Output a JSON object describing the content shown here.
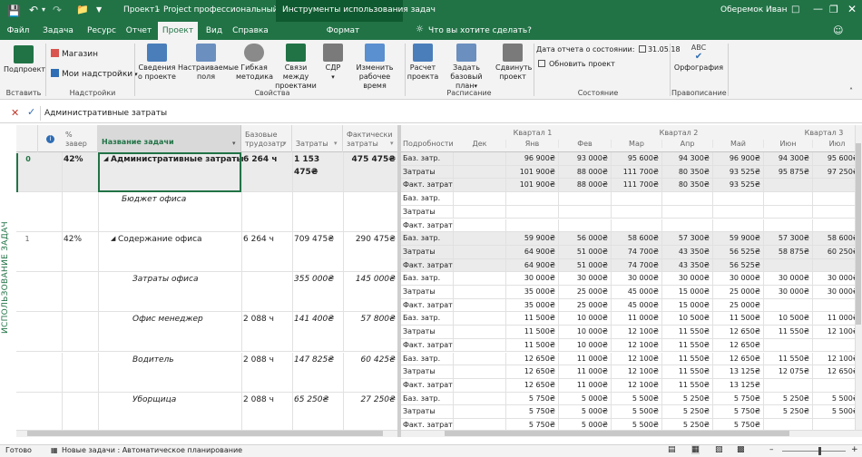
{
  "title": {
    "doc": "Проект1",
    "sep": "-",
    "app": "Project профессиональный",
    "context": "Инструменты использования задач",
    "user": "Оберемок Иван"
  },
  "tabs": [
    "Файл",
    "Задача",
    "Ресурс",
    "Отчет",
    "Проект",
    "Вид",
    "Справка",
    "Формат"
  ],
  "search_hint": "Что вы хотите сделать?",
  "ribbon": {
    "podproekt": "Подпроект",
    "magazin": "Магазин",
    "nadstroyki": "Мои надстройки",
    "svedeniya": [
      "Сведения",
      "о проекте"
    ],
    "pole": [
      "Настраиваемые",
      "поля"
    ],
    "metodika": [
      "Гибкая",
      "методика"
    ],
    "svyazi": [
      "Связи между",
      "проектами"
    ],
    "sdr": "СДР",
    "izmenit": [
      "Изменить",
      "рабочее время"
    ],
    "raschet": [
      "Расчет",
      "проекта"
    ],
    "bazovy": [
      "Задать базовый",
      "план"
    ],
    "sdvinut": [
      "Сдвинуть",
      "проект"
    ],
    "data_otcheta_label": "Дата отчета о состоянии:",
    "data_otcheta": "31.05.18",
    "obnovit": "Обновить проект",
    "orfografiya": "Орфография",
    "abc": "ABC",
    "groups": [
      "Вставить",
      "Надстройки",
      "Свойства",
      "Расписание",
      "Состояние",
      "Правописание"
    ]
  },
  "formula": "Административные затраты",
  "side_label": "ИСПОЛЬЗОВАНИЕ ЗАДАЧ",
  "left_headers": {
    "pct": [
      "%",
      "завер"
    ],
    "name": "Название задачи",
    "base": [
      "Базовые",
      "трудозатр"
    ],
    "cost": "Затраты",
    "actual": [
      "Фактически",
      "затраты"
    ]
  },
  "right_headers": {
    "details": "Подробности",
    "q1": "Квартал 1",
    "q2": "Квартал 2",
    "q3": "Квартал 3",
    "months": [
      "Дек",
      "Янв",
      "Фев",
      "Мар",
      "Апр",
      "Май",
      "Июн",
      "Июл"
    ]
  },
  "rows": [
    {
      "id": "0",
      "pct": "42%",
      "name": "Административные затраты",
      "base": "6 264 ч",
      "cost": "1 153 475₴",
      "actual": "475 475₴",
      "style": "summary0",
      "lines": [
        {
          "label": "Баз. затр.",
          "vals": [
            "",
            "96 900₴",
            "93 000₴",
            "95 600₴",
            "94 300₴",
            "96 900₴",
            "94 300₴",
            "95 600₴"
          ]
        },
        {
          "label": "Затраты",
          "vals": [
            "",
            "101 900₴",
            "88 000₴",
            "111 700₴",
            "80 350₴",
            "93 525₴",
            "95 875₴",
            "97 250₴"
          ]
        },
        {
          "label": "Факт. затрат",
          "vals": [
            "",
            "101 900₴",
            "88 000₴",
            "111 700₴",
            "80 350₴",
            "93 525₴",
            "",
            ""
          ]
        }
      ]
    },
    {
      "id": "",
      "pct": "",
      "name": "Бюджет офиса",
      "base": "",
      "cost": "",
      "actual": "",
      "style": "budget",
      "lines": [
        {
          "label": "Баз. затр.",
          "vals": [
            "",
            "",
            "",
            "",
            "",
            "",
            "",
            ""
          ]
        },
        {
          "label": "Затраты",
          "vals": [
            "",
            "",
            "",
            "",
            "",
            "",
            "",
            ""
          ]
        },
        {
          "label": "Факт. затрат",
          "vals": [
            "",
            "",
            "",
            "",
            "",
            "",
            "",
            ""
          ]
        }
      ]
    },
    {
      "id": "1",
      "pct": "42%",
      "name": "Содержание офиса",
      "base": "6 264 ч",
      "cost": "709 475₴",
      "actual": "290 475₴",
      "style": "summary1",
      "lines": [
        {
          "label": "Баз. затр.",
          "vals": [
            "",
            "59 900₴",
            "56 000₴",
            "58 600₴",
            "57 300₴",
            "59 900₴",
            "57 300₴",
            "58 600₴"
          ]
        },
        {
          "label": "Затраты",
          "vals": [
            "",
            "64 900₴",
            "51 000₴",
            "74 700₴",
            "43 350₴",
            "56 525₴",
            "58 875₴",
            "60 250₴"
          ]
        },
        {
          "label": "Факт. затрат",
          "vals": [
            "",
            "64 900₴",
            "51 000₴",
            "74 700₴",
            "43 350₴",
            "56 525₴",
            "",
            ""
          ]
        }
      ]
    },
    {
      "id": "",
      "pct": "",
      "name": "Затраты офиса",
      "base": "",
      "cost": "355 000₴",
      "actual": "145 000₴",
      "style": "child",
      "lines": [
        {
          "label": "Баз. затр.",
          "vals": [
            "",
            "30 000₴",
            "30 000₴",
            "30 000₴",
            "30 000₴",
            "30 000₴",
            "30 000₴",
            "30 000₴"
          ]
        },
        {
          "label": "Затраты",
          "vals": [
            "",
            "35 000₴",
            "25 000₴",
            "45 000₴",
            "15 000₴",
            "25 000₴",
            "30 000₴",
            "30 000₴"
          ]
        },
        {
          "label": "Факт. затрат",
          "vals": [
            "",
            "35 000₴",
            "25 000₴",
            "45 000₴",
            "15 000₴",
            "25 000₴",
            "",
            ""
          ]
        }
      ]
    },
    {
      "id": "",
      "pct": "",
      "name": "Офис менеджер",
      "base": "2 088 ч",
      "cost": "141 400₴",
      "actual": "57 800₴",
      "style": "child",
      "lines": [
        {
          "label": "Баз. затр.",
          "vals": [
            "",
            "11 500₴",
            "10 000₴",
            "11 000₴",
            "10 500₴",
            "11 500₴",
            "10 500₴",
            "11 000₴"
          ]
        },
        {
          "label": "Затраты",
          "vals": [
            "",
            "11 500₴",
            "10 000₴",
            "12 100₴",
            "11 550₴",
            "12 650₴",
            "11 550₴",
            "12 100₴"
          ]
        },
        {
          "label": "Факт. затрат",
          "vals": [
            "",
            "11 500₴",
            "10 000₴",
            "12 100₴",
            "11 550₴",
            "12 650₴",
            "",
            ""
          ]
        }
      ]
    },
    {
      "id": "",
      "pct": "",
      "name": "Водитель",
      "base": "2 088 ч",
      "cost": "147 825₴",
      "actual": "60 425₴",
      "style": "child",
      "lines": [
        {
          "label": "Баз. затр.",
          "vals": [
            "",
            "12 650₴",
            "11 000₴",
            "12 100₴",
            "11 550₴",
            "12 650₴",
            "11 550₴",
            "12 100₴"
          ]
        },
        {
          "label": "Затраты",
          "vals": [
            "",
            "12 650₴",
            "11 000₴",
            "12 100₴",
            "11 550₴",
            "13 125₴",
            "12 075₴",
            "12 650₴"
          ]
        },
        {
          "label": "Факт. затрат",
          "vals": [
            "",
            "12 650₴",
            "11 000₴",
            "12 100₴",
            "11 550₴",
            "13 125₴",
            "",
            ""
          ]
        }
      ]
    },
    {
      "id": "",
      "pct": "",
      "name": "Уборщица",
      "base": "2 088 ч",
      "cost": "65 250₴",
      "actual": "27 250₴",
      "style": "child",
      "lines": [
        {
          "label": "Баз. затр.",
          "vals": [
            "",
            "5 750₴",
            "5 000₴",
            "5 500₴",
            "5 250₴",
            "5 750₴",
            "5 250₴",
            "5 500₴"
          ]
        },
        {
          "label": "Затраты",
          "vals": [
            "",
            "5 750₴",
            "5 000₴",
            "5 500₴",
            "5 250₴",
            "5 750₴",
            "5 250₴",
            "5 500₴"
          ]
        },
        {
          "label": "Факт. затрат",
          "vals": [
            "",
            "5 750₴",
            "5 000₴",
            "5 500₴",
            "5 250₴",
            "5 750₴",
            "",
            ""
          ]
        }
      ]
    }
  ],
  "status": {
    "ready": "Готово",
    "newtasks": "Новые задачи : Автоматическое планирование"
  },
  "colors": {
    "green": "#217346",
    "summary_bg": "#ebebeb",
    "grid": "#e1e1e1",
    "header_bg": "#f3f3f3"
  }
}
